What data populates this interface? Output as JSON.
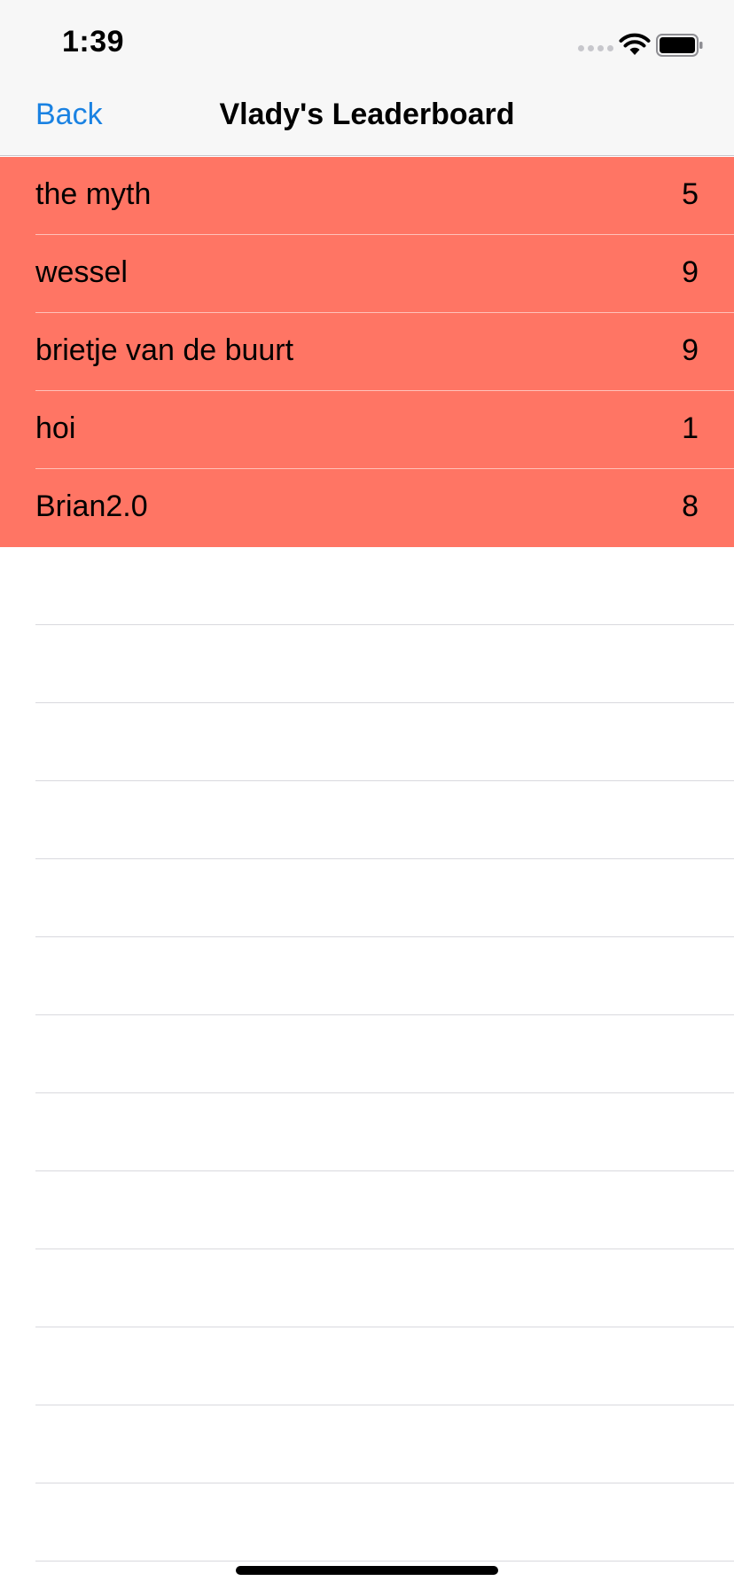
{
  "status_bar": {
    "time": "1:39"
  },
  "nav": {
    "back_label": "Back",
    "title": "Vlady's Leaderboard"
  },
  "leaderboard": {
    "row_color": "#ff7564",
    "accent_color": "#1a82e2",
    "entries": [
      {
        "name": "the myth",
        "score": "5"
      },
      {
        "name": "wessel",
        "score": "9"
      },
      {
        "name": "brietje van de buurt",
        "score": "9"
      },
      {
        "name": "hoi",
        "score": "1"
      },
      {
        "name": "Brian2.0",
        "score": "8"
      }
    ]
  },
  "icons": {
    "signal": "signal-dots-icon",
    "wifi": "wifi-icon",
    "battery": "battery-icon"
  }
}
